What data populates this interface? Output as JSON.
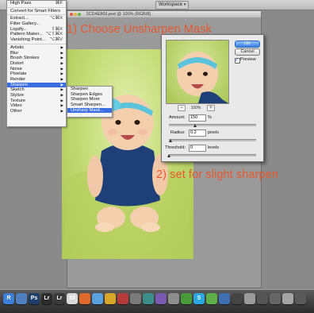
{
  "toolbar": {
    "workspace_label": "Workspace",
    "chevron": "▾"
  },
  "document": {
    "title": "3CD4E869.psd @ 100% (RGB/8)"
  },
  "filter_menu": {
    "items": [
      {
        "label": "High Pass",
        "shortcut": "⌘F",
        "arrow": ""
      },
      {
        "label": "",
        "shortcut": "",
        "arrow": "",
        "sep": true
      },
      {
        "label": "Convert for Smart Filters",
        "shortcut": "",
        "arrow": ""
      },
      {
        "label": "",
        "shortcut": "",
        "arrow": "",
        "sep": true
      },
      {
        "label": "Extract...",
        "shortcut": "⌥⌘X",
        "arrow": ""
      },
      {
        "label": "Filter Gallery...",
        "shortcut": "",
        "arrow": ""
      },
      {
        "label": "Liquify...",
        "shortcut": "⇧⌘X",
        "arrow": ""
      },
      {
        "label": "Pattern Maker...",
        "shortcut": "⌥⇧⌘X",
        "arrow": ""
      },
      {
        "label": "Vanishing Point...",
        "shortcut": "⌥⌘V",
        "arrow": ""
      },
      {
        "label": "",
        "shortcut": "",
        "arrow": "",
        "sep": true
      },
      {
        "label": "Artistic",
        "shortcut": "",
        "arrow": "▶"
      },
      {
        "label": "Blur",
        "shortcut": "",
        "arrow": "▶"
      },
      {
        "label": "Brush Strokes",
        "shortcut": "",
        "arrow": "▶"
      },
      {
        "label": "Distort",
        "shortcut": "",
        "arrow": "▶"
      },
      {
        "label": "Noise",
        "shortcut": "",
        "arrow": "▶"
      },
      {
        "label": "Pixelate",
        "shortcut": "",
        "arrow": "▶"
      },
      {
        "label": "Render",
        "shortcut": "",
        "arrow": "▶"
      },
      {
        "label": "Sharpen",
        "shortcut": "",
        "arrow": "▶",
        "selected": true
      },
      {
        "label": "Sketch",
        "shortcut": "",
        "arrow": "▶"
      },
      {
        "label": "Stylize",
        "shortcut": "",
        "arrow": "▶"
      },
      {
        "label": "Texture",
        "shortcut": "",
        "arrow": "▶"
      },
      {
        "label": "Video",
        "shortcut": "",
        "arrow": "▶"
      },
      {
        "label": "Other",
        "shortcut": "",
        "arrow": "▶"
      }
    ]
  },
  "sharpen_submenu": {
    "items": [
      {
        "label": "Sharpen"
      },
      {
        "label": "Sharpen Edges"
      },
      {
        "label": "Sharpen More"
      },
      {
        "label": "Smart Sharpen..."
      },
      {
        "label": "Unsharp Mask...",
        "selected": true
      }
    ]
  },
  "dialog": {
    "ok_label": "OK",
    "cancel_label": "Cancel",
    "preview_label": "Preview",
    "preview_checked": true,
    "zoom_out": "−",
    "zoom_in": "+",
    "zoom_level": "100%",
    "amount_label": "Amount:",
    "amount_value": "150",
    "amount_unit": "%",
    "amount_fraction": 0.3,
    "radius_label": "Radius:",
    "radius_value": "0.2",
    "radius_unit": "pixels",
    "radius_fraction": 0.02,
    "threshold_label": "Threshold:",
    "threshold_value": "0",
    "threshold_unit": "levels",
    "threshold_fraction": 0.0
  },
  "annotations": {
    "step1": "1) Choose Unsharpen Mask",
    "step2": "2) set for slight sharpen"
  },
  "colors": {
    "accent": "#e8592e",
    "menu_highlight": "#3a6ee0",
    "photo_background": "#c7dd7a"
  },
  "dock": {
    "icons": [
      {
        "name": "finder-icon",
        "label": "R",
        "color": "#3b7fd9"
      },
      {
        "name": "app-icon-blue",
        "label": "",
        "color": "#4e7fbf"
      },
      {
        "name": "photoshop-icon",
        "label": "Ps",
        "color": "#1f3e6b"
      },
      {
        "name": "lightroom-icon",
        "label": "Lr",
        "color": "#2c2c2c"
      },
      {
        "name": "lightroom-alt-icon",
        "label": "Lr",
        "color": "#3a3a3a"
      },
      {
        "name": "calendar-icon",
        "label": "18",
        "color": "#d9d9d9"
      },
      {
        "name": "firefox-icon",
        "label": "",
        "color": "#e06a2a"
      },
      {
        "name": "safari-icon",
        "label": "",
        "color": "#5aa0dc"
      },
      {
        "name": "app-icon-yellow",
        "label": "",
        "color": "#d6a52a"
      },
      {
        "name": "app-icon-red",
        "label": "",
        "color": "#b73a3a"
      },
      {
        "name": "app-icon-gray",
        "label": "",
        "color": "#7a7a7a"
      },
      {
        "name": "app-icon-teal",
        "label": "",
        "color": "#3c8c8c"
      },
      {
        "name": "app-icon-purple",
        "label": "",
        "color": "#7a5ab0"
      },
      {
        "name": "app-icon-gray2",
        "label": "",
        "color": "#8d8d8d"
      },
      {
        "name": "app-icon-green",
        "label": "",
        "color": "#4a9a3a"
      },
      {
        "name": "skype-icon",
        "label": "S",
        "color": "#2aa6e0"
      },
      {
        "name": "app-icon-green2",
        "label": "",
        "color": "#5fae4a"
      },
      {
        "name": "app-icon-blue2",
        "label": "",
        "color": "#3f6fb0"
      },
      {
        "name": "app-icon-dark",
        "label": "",
        "color": "#444444"
      },
      {
        "name": "app-icon-silver",
        "label": "",
        "color": "#9a9a9a"
      },
      {
        "name": "app-icon-dark2",
        "label": "",
        "color": "#555555"
      },
      {
        "name": "printer-icon",
        "label": "",
        "color": "#666666"
      },
      {
        "name": "app-icon-silver2",
        "label": "",
        "color": "#a5a5a5"
      },
      {
        "name": "bluetooth-icon",
        "label": "",
        "color": "#5a5a5a"
      }
    ]
  }
}
